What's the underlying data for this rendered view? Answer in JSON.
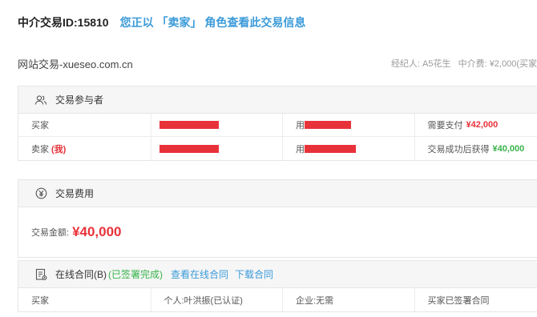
{
  "header": {
    "transaction_id": "中介交易ID:15810",
    "role_notice": "您正以 「卖家」 角色查看此交易信息"
  },
  "siteline": {
    "site_name": "网站交易-xueseo.com.cn",
    "broker": "经纪人: A5花生",
    "fee": "中介费: ¥2,000(买家"
  },
  "participants": {
    "title": "交易参与者",
    "buyer": {
      "role_label": "买家",
      "account_prefix": "用",
      "pay_label": "需要支付",
      "pay_amount": "¥42,000"
    },
    "seller": {
      "role_label": "卖家",
      "me_tag": "(我)",
      "account_prefix": "用",
      "receive_label": "交易成功后获得",
      "receive_amount": "¥40,000"
    }
  },
  "fees": {
    "title": "交易费用",
    "amount_label": "交易金额:",
    "amount_value": "¥40,000"
  },
  "contract": {
    "title": "在线合同(B)",
    "status": "(已签署完成)",
    "view_link": "查看在线合同",
    "download_link": "下载合同",
    "row": {
      "role": "买家",
      "personal": "个人:叶洪振(已认证)",
      "company": "企业:无需",
      "state": "买家已签署合同"
    }
  },
  "colors": {
    "accent_blue": "#3a9ad9",
    "price_red": "#e8323a",
    "success_green": "#37b34a"
  },
  "icons": {
    "participants": "users-icon",
    "fees": "yen-circle-icon",
    "contract": "contract-document-icon"
  }
}
